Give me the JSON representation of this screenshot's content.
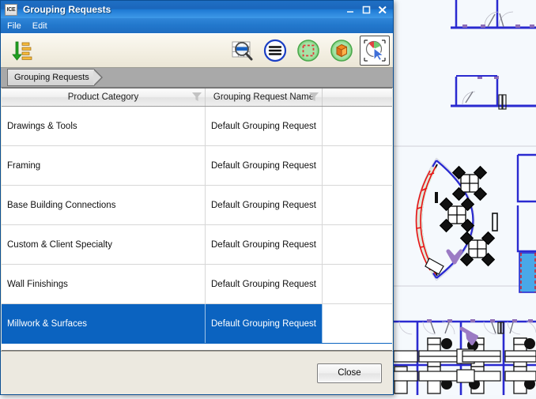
{
  "window": {
    "app_icon_text": "ICE",
    "title": "Grouping Requests",
    "buttons": {
      "minimize": "minimize-icon",
      "maximize": "maximize-icon",
      "close": "close-icon"
    }
  },
  "menubar": {
    "items": [
      {
        "label": "File"
      },
      {
        "label": "Edit"
      }
    ]
  },
  "toolbar": {
    "left_icons": [
      {
        "name": "sort-descending-icon"
      }
    ],
    "right_icons": [
      {
        "name": "zoom-table-icon",
        "pressed": false
      },
      {
        "name": "list-menu-icon",
        "pressed": false
      },
      {
        "name": "marquee-select-icon",
        "pressed": false
      },
      {
        "name": "box-solid-select-icon",
        "pressed": false
      },
      {
        "name": "pick-pointer-icon",
        "pressed": true
      }
    ]
  },
  "breadcrumb": {
    "items": [
      {
        "label": "Grouping Requests"
      }
    ]
  },
  "table": {
    "columns": [
      {
        "key": "product_category",
        "label": "Product Category",
        "filter_icon": "filter-funnel-icon"
      },
      {
        "key": "grouping_request_name",
        "label": "Grouping Request Name",
        "filter_icon": "filter-funnel-icon"
      },
      {
        "key": "spacer",
        "label": "",
        "filter_icon": ""
      }
    ],
    "rows": [
      {
        "product_category": "Drawings & Tools",
        "grouping_request_name": "Default Grouping Request",
        "selected": false
      },
      {
        "product_category": "Framing",
        "grouping_request_name": "Default Grouping Request",
        "selected": false
      },
      {
        "product_category": "Base Building Connections",
        "grouping_request_name": "Default Grouping Request",
        "selected": false
      },
      {
        "product_category": "Custom & Client Specialty",
        "grouping_request_name": "Default Grouping Request",
        "selected": false
      },
      {
        "product_category": "Wall Finishings",
        "grouping_request_name": "Default Grouping Request",
        "selected": false
      },
      {
        "product_category": "Millwork & Surfaces",
        "grouping_request_name": "Default Grouping Request",
        "selected": true
      }
    ]
  },
  "footer": {
    "close_label": "Close"
  },
  "background": {
    "name": "cad-floor-plan",
    "description": "architectural floor plan drawing"
  },
  "colors": {
    "title_bar_blue": "#1f6fc4",
    "menu_bar_blue": "#2277cc",
    "selection_blue": "#0b63c0",
    "toolbar_beige": "#f3efe2",
    "breadcrumb_gray": "#a9a9a9",
    "footer_gray": "#ece9e0",
    "cad_wall_blue": "#2a2ad0",
    "cad_accent_red": "#e81414",
    "cad_accent_purple": "#9b7ac4",
    "cad_fill_cyan": "#49a8e8"
  }
}
